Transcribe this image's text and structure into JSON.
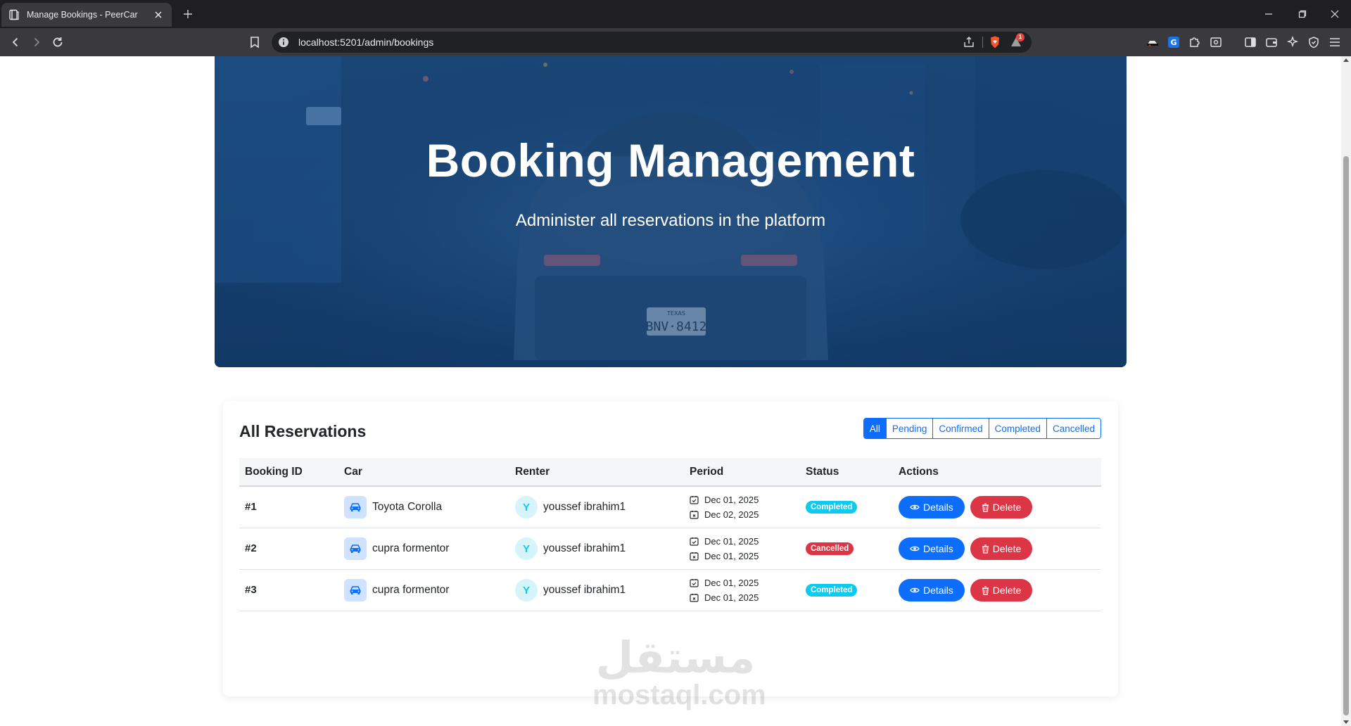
{
  "browser": {
    "tab_title": "Manage Bookings - PeerCar",
    "url": "localhost:5201/admin/bookings",
    "rewards_badge": "1"
  },
  "hero": {
    "title": "Booking Management",
    "subtitle": "Administer all reservations in the platform"
  },
  "reservations": {
    "title": "All Reservations",
    "filters": [
      "All",
      "Pending",
      "Confirmed",
      "Completed",
      "Cancelled"
    ],
    "active_filter": "All",
    "columns": [
      "Booking ID",
      "Car",
      "Renter",
      "Period",
      "Status",
      "Actions"
    ],
    "rows": [
      {
        "id": "#1",
        "car": "Toyota Corolla",
        "renter_initial": "Y",
        "renter": "youssef ibrahim1",
        "start": "Dec 01, 2025",
        "end": "Dec 02, 2025",
        "status": "Completed"
      },
      {
        "id": "#2",
        "car": "cupra formentor",
        "renter_initial": "Y",
        "renter": "youssef ibrahim1",
        "start": "Dec 01, 2025",
        "end": "Dec 01, 2025",
        "status": "Cancelled"
      },
      {
        "id": "#3",
        "car": "cupra formentor",
        "renter_initial": "Y",
        "renter": "youssef ibrahim1",
        "start": "Dec 01, 2025",
        "end": "Dec 01, 2025",
        "status": "Completed"
      }
    ],
    "details_label": "Details",
    "delete_label": "Delete"
  },
  "colors": {
    "primary": "#0d6efd",
    "danger": "#dc3545",
    "completed": "#0dcaf0",
    "cancelled": "#dc3545",
    "hero": "#1b4a82"
  },
  "watermark": {
    "arabic": "مستقل",
    "latin": "mostaql.com"
  }
}
